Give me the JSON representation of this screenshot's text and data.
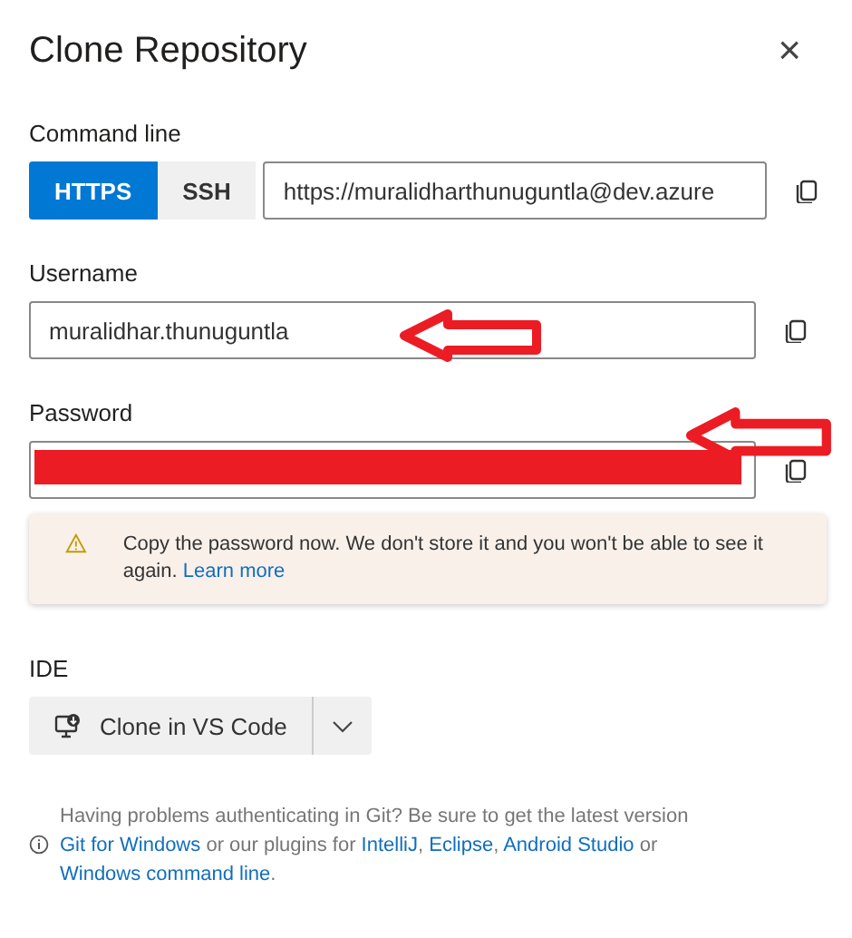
{
  "dialog": {
    "title": "Clone Repository",
    "close": "×"
  },
  "command_line": {
    "label": "Command line",
    "protocols": [
      {
        "label": "HTTPS",
        "selected": true
      },
      {
        "label": "SSH",
        "selected": false
      }
    ],
    "url": "https://muralidharthunuguntla@dev.azure"
  },
  "username": {
    "label": "Username",
    "value": "muralidhar.thunuguntla"
  },
  "password": {
    "label": "Password",
    "redacted": true
  },
  "warning": {
    "text": "Copy the password now. We don't store it and you won't be able to see it again.",
    "link": "Learn more"
  },
  "ide": {
    "label": "IDE",
    "button": "Clone in VS Code"
  },
  "help": [
    {
      "text": "Having problems authenticating in Git? Be sure to get the latest version ",
      "link": false
    },
    {
      "text": "Git for Windows",
      "link": true
    },
    {
      "text": " or our plugins for ",
      "link": false
    },
    {
      "text": "IntelliJ",
      "link": true
    },
    {
      "text": ", ",
      "link": false
    },
    {
      "text": "Eclipse",
      "link": true
    },
    {
      "text": ", ",
      "link": false
    },
    {
      "text": "Android Studio",
      "link": true
    },
    {
      "text": " or ",
      "link": false
    },
    {
      "text": "Windows command line",
      "link": true
    },
    {
      "text": ".",
      "link": false
    }
  ],
  "annotations": [
    {
      "kind": "arrow"
    },
    {
      "kind": "arrow"
    }
  ]
}
